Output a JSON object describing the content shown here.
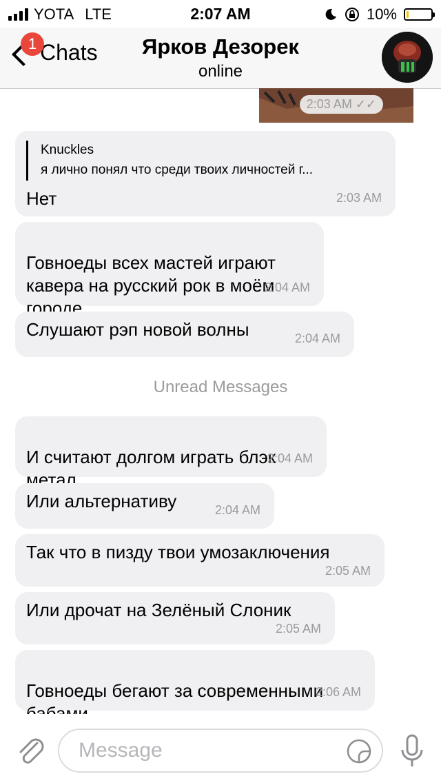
{
  "status_bar": {
    "carrier": "YOTA",
    "network": "LTE",
    "time": "2:07 AM",
    "battery": "10%",
    "battery_level": 0.1,
    "battery_color": "#f5c400"
  },
  "nav": {
    "back_label": "Chats",
    "unread_badge": "1",
    "title": "Ярков Дезорек",
    "subtitle": "online",
    "badge_color": "#e9473b"
  },
  "messages": [
    {
      "text": "Нет",
      "time": "2:03 AM",
      "reply": {
        "name": "Knuckles",
        "text": "я лично понял что среди твоих личностей г..."
      }
    },
    {
      "text": "Говноеды всех мастей играют\nкавера на русский рок в моём\nгороде",
      "time": "2:04 AM"
    },
    {
      "text": "Слушают рэп новой волны",
      "time": "2:04 AM"
    },
    {
      "text": "И считают долгом играть блэк\nметал",
      "time": "2:04 AM"
    },
    {
      "text": "Или альтернативу",
      "time": "2:04 AM"
    },
    {
      "text": "Так что в пизду твои умозаключения",
      "time": "2:05 AM"
    },
    {
      "text": "Или дрочат на Зелёный Слоник",
      "time": "2:05 AM"
    },
    {
      "text": "Говноеды бегают за современными\nбабами",
      "time": "2:06 AM"
    }
  ],
  "sticker_time": "2:03 AM",
  "unread_divider": "Unread Messages",
  "input": {
    "placeholder": "Message"
  },
  "icons": {
    "attach": "paperclip-icon",
    "sticker": "sticker-icon",
    "mic": "microphone-icon",
    "back": "chevron-left-icon",
    "read": "double-check-icon"
  }
}
